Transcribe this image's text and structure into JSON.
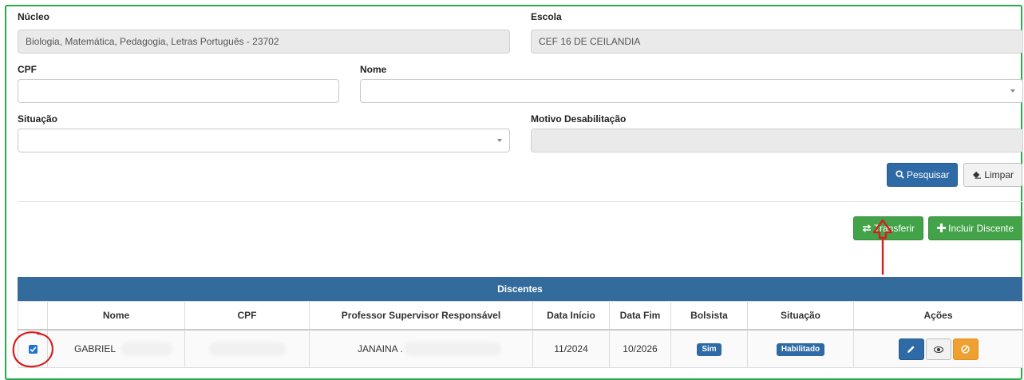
{
  "form": {
    "nucleo": {
      "label": "Núcleo",
      "value": "Biologia, Matemática, Pedagogia, Letras Português - 23702"
    },
    "escola": {
      "label": "Escola",
      "value": "CEF 16 DE CEILANDIA"
    },
    "cpf": {
      "label": "CPF",
      "value": ""
    },
    "nome": {
      "label": "Nome",
      "value": ""
    },
    "situacao": {
      "label": "Situação",
      "value": ""
    },
    "motivo": {
      "label": "Motivo Desabilitação",
      "value": ""
    }
  },
  "buttons": {
    "pesquisar": "Pesquisar",
    "limpar": "Limpar",
    "transferir": "Transferir",
    "incluir": "Incluir Discente"
  },
  "icons": {
    "pesquisar": "search-icon",
    "limpar": "eraser-icon",
    "transferir": "transfer-icon",
    "incluir": "plus-icon",
    "edit": "pencil-icon",
    "view": "eye-icon",
    "disable": "ban-icon"
  },
  "colors": {
    "primary": "#2e6aa6",
    "success": "#43a348",
    "warning": "#f0a030",
    "table_header": "#336b9c",
    "annotation": "#d62020"
  },
  "table": {
    "title": "Discentes",
    "columns": [
      "",
      "Nome",
      "CPF",
      "Professor Supervisor Responsável",
      "Data Início",
      "Data Fim",
      "Bolsista",
      "Situação",
      "Ações"
    ],
    "rows": [
      {
        "checked": true,
        "nome": "GABRIEL",
        "cpf": "",
        "professor": "JANAINA .",
        "inicio": "11/2024",
        "fim": "10/2026",
        "bolsista": "Sim",
        "situacao": "Habilitado"
      }
    ]
  }
}
